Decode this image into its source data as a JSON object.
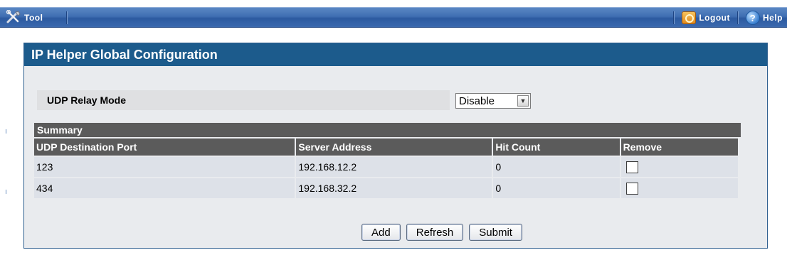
{
  "toolbar": {
    "tool_label": "Tool",
    "logout_label": "Logout",
    "help_label": "Help"
  },
  "panel": {
    "title": "IP Helper Global Configuration",
    "relay_mode_label": "UDP Relay Mode",
    "relay_mode_value": "Disable",
    "summary_label": "Summary",
    "columns": [
      "UDP Destination Port",
      "Server Address",
      "Hit Count",
      "Remove"
    ],
    "rows": [
      {
        "port": "123",
        "server": "192.168.12.2",
        "hits": "0",
        "remove": false
      },
      {
        "port": "434",
        "server": "192.168.32.2",
        "hits": "0",
        "remove": false
      }
    ],
    "buttons": {
      "add": "Add",
      "refresh": "Refresh",
      "submit": "Submit"
    }
  }
}
